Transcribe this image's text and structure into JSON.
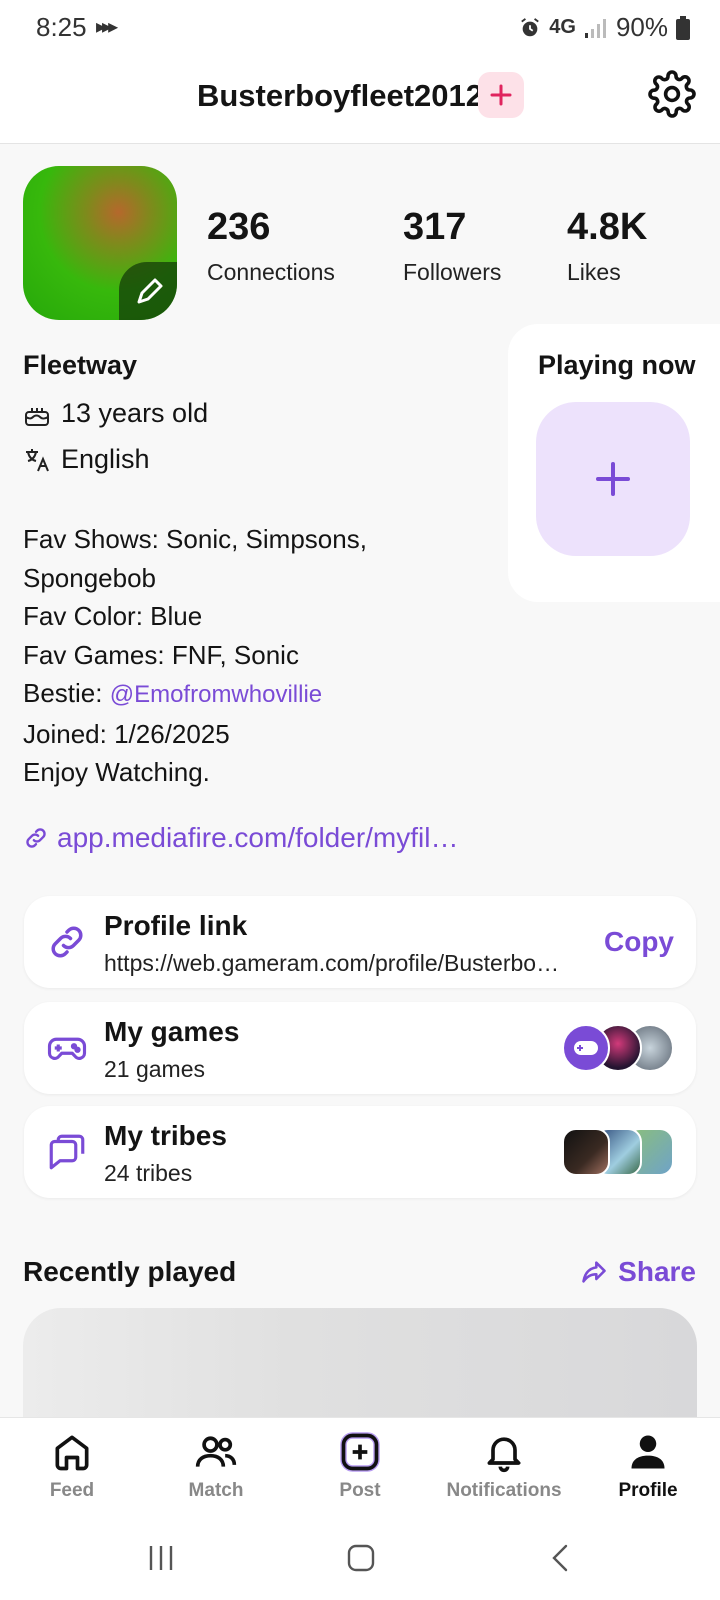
{
  "status": {
    "time": "8:25",
    "network": "4G",
    "battery": "90%"
  },
  "header": {
    "username": "Busterboyfleet2012"
  },
  "stats": [
    {
      "value": "236",
      "label": "Connections"
    },
    {
      "value": "317",
      "label": "Followers"
    },
    {
      "value": "4.8K",
      "label": "Likes"
    }
  ],
  "profile": {
    "display_name": "Fleetway",
    "age": "13 years old",
    "language": "English",
    "bio": {
      "line1": "Fav Shows: Sonic, Simpsons,",
      "line2": "Spongebob",
      "line3": "Fav Color: Blue",
      "line4": "Fav Games: FNF, Sonic",
      "bestie_prefix": "Bestie: ",
      "bestie_mention": "@Emofromwhovillie",
      "line6": "Joined: 1/26/2025",
      "line7": "Enjoy Watching."
    },
    "website": "app.mediafire.com/folder/myfil…"
  },
  "playing_now": {
    "title": "Playing now"
  },
  "cards": {
    "profile_link": {
      "title": "Profile link",
      "url": "https://web.gameram.com/profile/Busterbo…",
      "action": "Copy"
    },
    "games": {
      "title": "My games",
      "subtitle": "21 games"
    },
    "tribes": {
      "title": "My tribes",
      "subtitle": "24 tribes"
    }
  },
  "recently_played": {
    "title": "Recently played",
    "share": "Share"
  },
  "nav": [
    {
      "label": "Feed",
      "icon": "home-icon"
    },
    {
      "label": "Match",
      "icon": "people-icon"
    },
    {
      "label": "Post",
      "icon": "plus-square-icon"
    },
    {
      "label": "Notifications",
      "icon": "bell-icon"
    },
    {
      "label": "Profile",
      "icon": "person-icon"
    }
  ],
  "colors": {
    "accent": "#7a4bd6",
    "pink": "#e0245e",
    "avatar_green": "#2fb00c"
  }
}
